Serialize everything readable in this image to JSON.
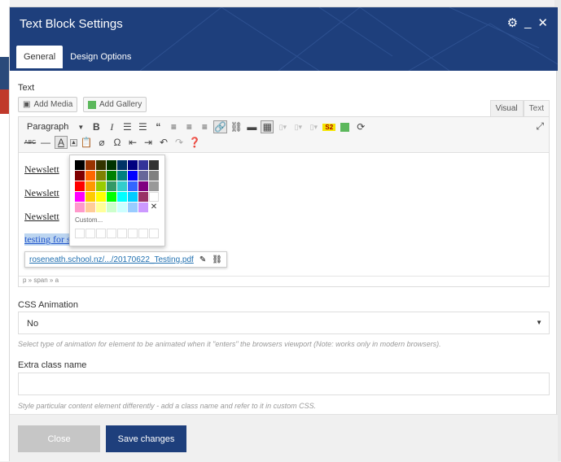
{
  "modal": {
    "title": "Text Block Settings",
    "icons": {
      "settings": "gear-icon",
      "minimize": "minimize-icon",
      "close": "close-icon"
    },
    "tabs": [
      {
        "label": "General",
        "active": true
      },
      {
        "label": "Design Options",
        "active": false
      }
    ]
  },
  "text_section": {
    "label": "Text",
    "add_media": "Add Media",
    "add_gallery": "Add Gallery",
    "view_tabs": [
      "Visual",
      "Text"
    ]
  },
  "toolbar": {
    "format_select": "Paragraph",
    "row1_icons": [
      "bold-icon",
      "italic-icon",
      "bullet-list-icon",
      "numbered-list-icon",
      "blockquote-icon",
      "align-left-icon",
      "align-center-icon",
      "align-right-icon",
      "link-icon",
      "unlink-icon",
      "read-more-icon",
      "toolbar-toggle-icon",
      "shortcode-icon",
      "s2-icon",
      "color-square-icon",
      "refresh-icon",
      "fullscreen-icon"
    ],
    "row2_icons": [
      "strikethrough-icon",
      "horizontal-line-icon",
      "text-color-icon",
      "text-color-dropdown-icon",
      "paste-text-icon",
      "clear-format-icon",
      "special-char-icon",
      "outdent-icon",
      "indent-icon",
      "undo-icon",
      "redo-icon",
      "help-icon"
    ]
  },
  "content": {
    "paragraphs": [
      "Newslett",
      "Newslett",
      "Newslett"
    ],
    "selected_text": "testing for screenshot",
    "link_url": "roseneath.school.nz/.../20170622_Testing.pdf",
    "status_path": "p » span » a"
  },
  "palette": {
    "custom_label": "Custom...",
    "colors": [
      "#000000",
      "#993300",
      "#333300",
      "#003300",
      "#003366",
      "#000080",
      "#333399",
      "#333333",
      "#800000",
      "#FF6600",
      "#808000",
      "#008000",
      "#008080",
      "#0000FF",
      "#666699",
      "#808080",
      "#FF0000",
      "#FF9900",
      "#99CC00",
      "#339966",
      "#33CCCC",
      "#3366FF",
      "#800080",
      "#999999",
      "#FF00FF",
      "#FFCC00",
      "#FFFF00",
      "#00FF00",
      "#00FFFF",
      "#00CCFF",
      "#993366",
      "#FFFFFF",
      "#FF99CC",
      "#FFCC99",
      "#FFFF99",
      "#CCFFCC",
      "#CCFFFF",
      "#99CCFF",
      "#CC99FF",
      "none"
    ]
  },
  "css_animation": {
    "label": "CSS Animation",
    "value": "No",
    "help": "Select type of animation for element to be animated when it \"enters\" the browsers viewport (Note: works only in modern browsers)."
  },
  "extra_class": {
    "label": "Extra class name",
    "value": "",
    "help": "Style particular content element differently - add a class name and refer to it in custom CSS."
  },
  "footer": {
    "close": "Close",
    "save": "Save changes"
  },
  "colors": {
    "header": "#1e3f7c",
    "save_button": "#1e3f7c",
    "close_button": "#c6c6c6"
  }
}
